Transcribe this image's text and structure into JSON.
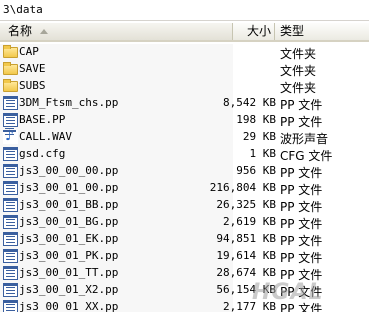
{
  "address": "3\\data",
  "columns": {
    "name": "名称",
    "size": "大小",
    "type": "类型"
  },
  "files": [
    {
      "name": "CAP",
      "size": "",
      "type": "文件夹",
      "icon": "folder-icon"
    },
    {
      "name": "SAVE",
      "size": "",
      "type": "文件夹",
      "icon": "folder-icon"
    },
    {
      "name": "SUBS",
      "size": "",
      "type": "文件夹",
      "icon": "folder-icon"
    },
    {
      "name": "3DM_Ftsm_chs.pp",
      "size": "8,542 KB",
      "type": "PP 文件",
      "icon": "file-icon"
    },
    {
      "name": "BASE.PP",
      "size": "198 KB",
      "type": "PP 文件",
      "icon": "file-icon"
    },
    {
      "name": "CALL.WAV",
      "size": "29 KB",
      "type": "波形声音",
      "icon": "audio-file-icon"
    },
    {
      "name": "gsd.cfg",
      "size": "1 KB",
      "type": "CFG 文件",
      "icon": "file-icon"
    },
    {
      "name": "js3_00_00_00.pp",
      "size": "956 KB",
      "type": "PP 文件",
      "icon": "file-icon"
    },
    {
      "name": "js3_00_01_00.pp",
      "size": "216,804 KB",
      "type": "PP 文件",
      "icon": "file-icon"
    },
    {
      "name": "js3_00_01_BB.pp",
      "size": "26,325 KB",
      "type": "PP 文件",
      "icon": "file-icon"
    },
    {
      "name": "js3_00_01_BG.pp",
      "size": "2,619 KB",
      "type": "PP 文件",
      "icon": "file-icon"
    },
    {
      "name": "js3_00_01_EK.pp",
      "size": "94,851 KB",
      "type": "PP 文件",
      "icon": "file-icon"
    },
    {
      "name": "js3_00_01_PK.pp",
      "size": "19,614 KB",
      "type": "PP 文件",
      "icon": "file-icon"
    },
    {
      "name": "js3_00_01_TT.pp",
      "size": "28,674 KB",
      "type": "PP 文件",
      "icon": "file-icon"
    },
    {
      "name": "js3_00_01_X2.pp",
      "size": "56,154 KB",
      "type": "PP 文件",
      "icon": "file-icon"
    },
    {
      "name": "js3_00_01_XX.pp",
      "size": "2,177 KB",
      "type": "PP 文件",
      "icon": "file-icon"
    }
  ],
  "watermark": "HGAL"
}
